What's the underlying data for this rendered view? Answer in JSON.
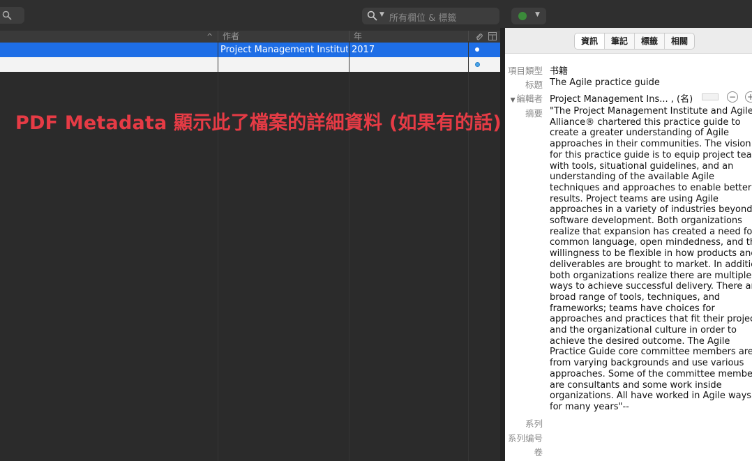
{
  "toolbar": {
    "search_placeholder": "所有欄位 & 標籤",
    "search_icon": "magnifier-icon",
    "action_icon": "gear-icon"
  },
  "list": {
    "columns": [
      "作者",
      "年"
    ],
    "rows": [
      {
        "author": "Project Management Institute",
        "year": "2017"
      },
      {
        "author": "",
        "year": ""
      }
    ]
  },
  "overlay_caption": "PDF Metadata 顯示此了檔案的詳細資料 (如果有的話)",
  "info": {
    "tabs": [
      "資訊",
      "筆記",
      "標籤",
      "相關"
    ],
    "fields": {
      "item_type_label": "項目類型",
      "item_type_value": "书籍",
      "title_label": "标题",
      "title_value": "The Agile practice guide",
      "editor_label": "編輯者",
      "editor_value": "Project Management Ins... , (名)",
      "abstract_label": "摘要",
      "abstract_lines": [
        "\"The Project Management Institute and Agile",
        "Alliance® chartered this practice guide to",
        "create a greater understanding of Agile",
        "approaches in their communities. The vision",
        "for this practice guide is to equip project teams",
        "with tools, situational guidelines, and an",
        "understanding of the available Agile",
        "techniques and approaches to enable better",
        "results. Project teams are using Agile",
        "approaches in a variety of industries beyond",
        "software development. Both organizations",
        "realize that expansion has created a need for a",
        "common language, open mindedness, and the",
        "willingness to be flexible in how products and",
        "deliverables are brought to market. In addition,",
        "both organizations realize there are multiple",
        "ways to achieve successful delivery. There are a",
        "broad range of tools, techniques, and",
        "frameworks; teams have choices for",
        "approaches and practices that fit their project",
        "and the organizational culture in order to",
        "achieve the desired outcome. The Agile",
        "Practice Guide core committee members are",
        "from varying backgrounds and use various",
        "approaches. Some of the committee members",
        "are consultants and some work inside",
        "organizations. All have worked in Agile ways",
        "for many years\"--"
      ],
      "series_label": "系列",
      "series_number_label": "系列编号",
      "volume_label": "卷"
    }
  },
  "colors": {
    "selection": "#1e6ee6",
    "overlay_text": "#e63b45"
  }
}
